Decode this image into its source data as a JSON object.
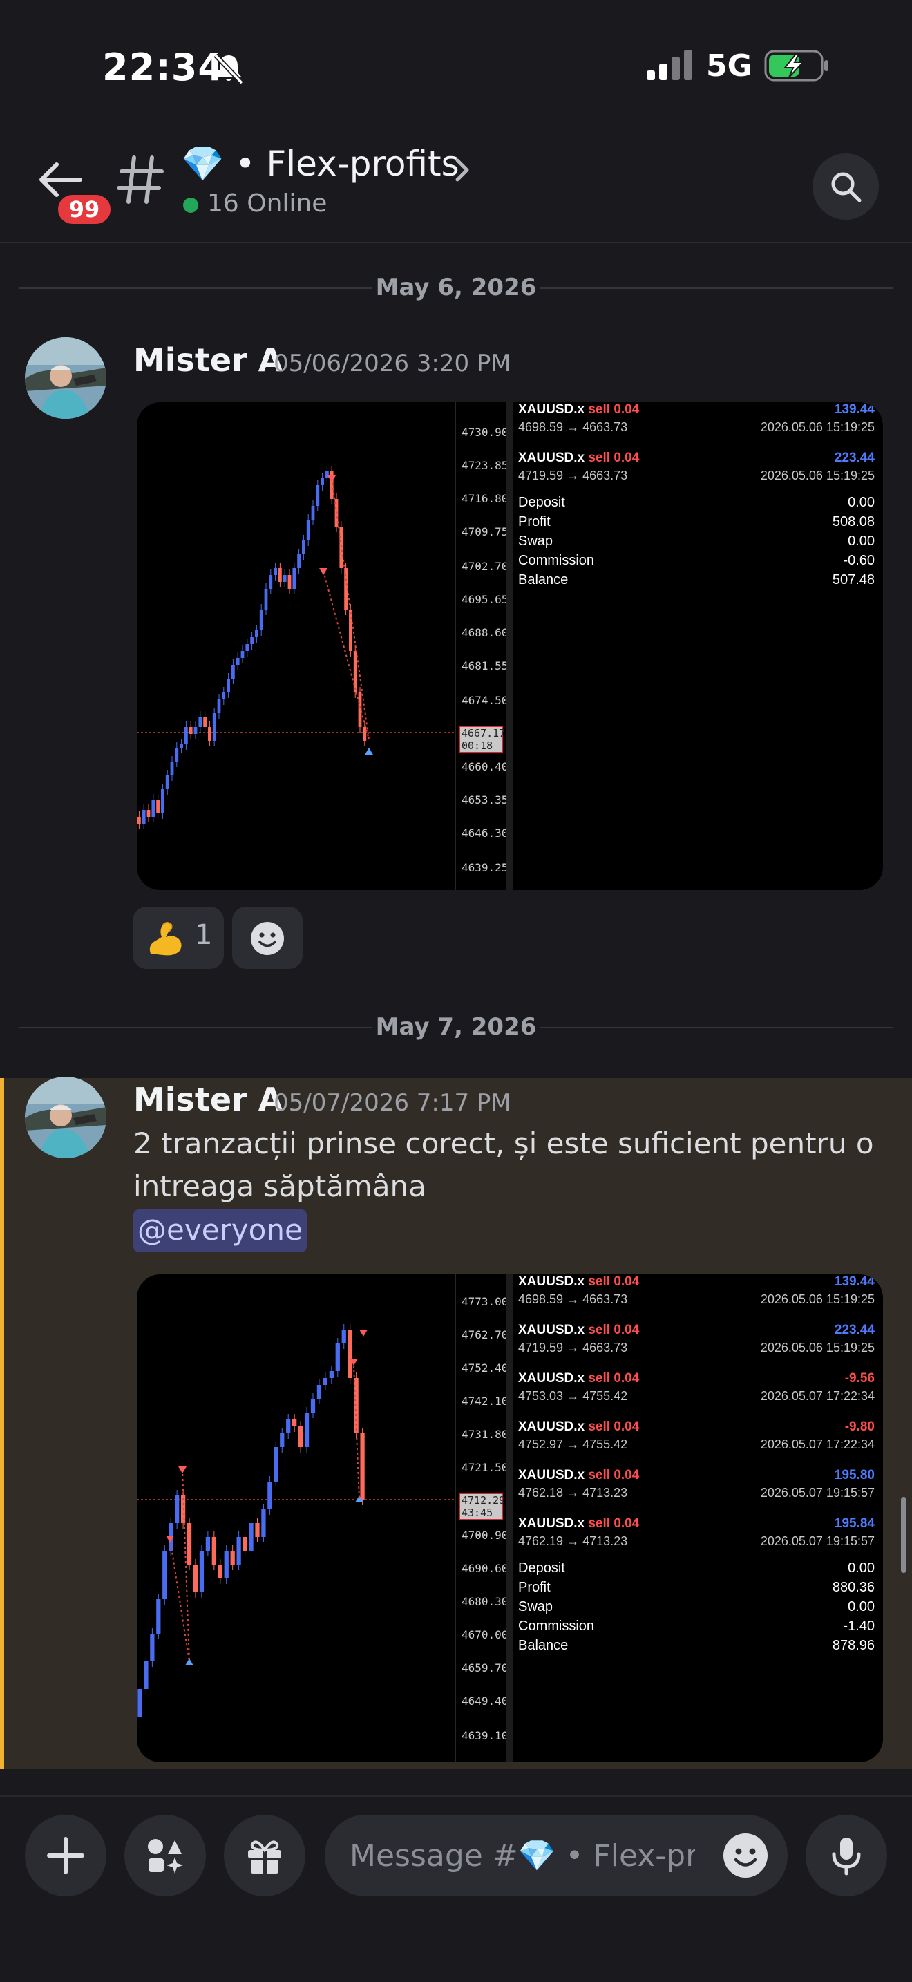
{
  "status_bar": {
    "time": "22:34",
    "network": "5G"
  },
  "header": {
    "unread_badge": "99",
    "channel_title": "💎 • Flex-profits",
    "online_status": "16 Online"
  },
  "date_dividers": [
    "May 6, 2026",
    "May 7, 2026"
  ],
  "messages": [
    {
      "author": "Mister A",
      "timestamp": "05/06/2026 3:20 PM",
      "attachment": {
        "price_ticks": [
          "4730.90",
          "4723.85",
          "4716.80",
          "4709.75",
          "4702.70",
          "4695.65",
          "4688.60",
          "4681.55",
          "4674.50",
          "4660.40",
          "4653.35",
          "4646.30",
          "4639.25"
        ],
        "current_price": "4667.17",
        "timer": "00:18",
        "trades": [
          {
            "symbol": "XAUUSD.x",
            "side": "sell 0.04",
            "profit": "139.44",
            "prices": "4698.59 → 4663.73",
            "datetime": "2026.05.06 15:19:25"
          },
          {
            "symbol": "XAUUSD.x",
            "side": "sell 0.04",
            "profit": "223.44",
            "prices": "4719.59 → 4663.73",
            "datetime": "2026.05.06 15:19:25"
          }
        ],
        "summary": [
          {
            "label": "Deposit",
            "value": "0.00"
          },
          {
            "label": "Profit",
            "value": "508.08"
          },
          {
            "label": "Swap",
            "value": "0.00"
          },
          {
            "label": "Commission",
            "value": "-0.60"
          },
          {
            "label": "Balance",
            "value": "507.48"
          }
        ]
      },
      "reactions": [
        {
          "emoji": "flexed-biceps",
          "count": "1"
        }
      ]
    },
    {
      "author": "Mister A",
      "timestamp": "05/07/2026 7:17 PM",
      "text_line1": "2 tranzacții prinse corect, și este suficient pentru o",
      "text_line2": "intreaga săptămâna",
      "mention": "@everyone",
      "attachment": {
        "price_ticks": [
          "4773.00",
          "4762.70",
          "4752.40",
          "4742.10",
          "4731.80",
          "4721.50",
          "4700.90",
          "4690.60",
          "4680.30",
          "4670.00",
          "4659.70",
          "4649.40",
          "4639.10"
        ],
        "current_price": "4712.29",
        "timer": "43:45",
        "trades": [
          {
            "symbol": "XAUUSD.x",
            "side": "sell 0.04",
            "profit": "139.44",
            "prices": "4698.59 → 4663.73",
            "datetime": "2026.05.06 15:19:25"
          },
          {
            "symbol": "XAUUSD.x",
            "side": "sell 0.04",
            "profit": "223.44",
            "prices": "4719.59 → 4663.73",
            "datetime": "2026.05.06 15:19:25"
          },
          {
            "symbol": "XAUUSD.x",
            "side": "sell 0.04",
            "profit": "-9.56",
            "prices": "4753.03 → 4755.42",
            "datetime": "2026.05.07 17:22:34"
          },
          {
            "symbol": "XAUUSD.x",
            "side": "sell 0.04",
            "profit": "-9.80",
            "prices": "4752.97 → 4755.42",
            "datetime": "2026.05.07 17:22:34"
          },
          {
            "symbol": "XAUUSD.x",
            "side": "sell 0.04",
            "profit": "195.80",
            "prices": "4762.18 → 4713.23",
            "datetime": "2026.05.07 19:15:57"
          },
          {
            "symbol": "XAUUSD.x",
            "side": "sell 0.04",
            "profit": "195.84",
            "prices": "4762.19 → 4713.23",
            "datetime": "2026.05.07 19:15:57"
          }
        ],
        "summary": [
          {
            "label": "Deposit",
            "value": "0.00"
          },
          {
            "label": "Profit",
            "value": "880.36"
          },
          {
            "label": "Swap",
            "value": "0.00"
          },
          {
            "label": "Commission",
            "value": "-1.40"
          },
          {
            "label": "Balance",
            "value": "878.96"
          }
        ]
      }
    }
  ],
  "composer": {
    "placeholder": "Message #💎 • Flex-pr..."
  },
  "colors": {
    "profit_positive": "#4f7bff",
    "profit_negative": "#ff4d4d",
    "mention_bg": "#3d4176",
    "highlight_bar": "#f0b232",
    "online": "#23a55a"
  }
}
